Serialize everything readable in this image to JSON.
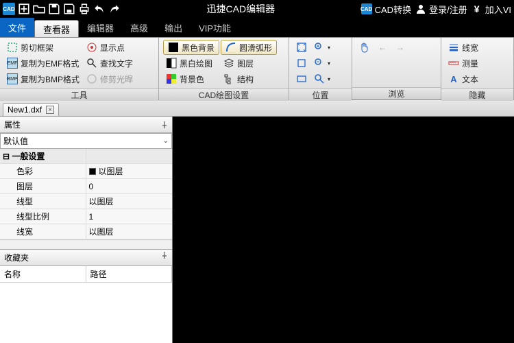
{
  "title": "迅捷CAD编辑器",
  "titlebar_right": {
    "convert": "CAD转换",
    "login": "登录/注册",
    "join": "加入VI"
  },
  "menu": {
    "file": "文件",
    "viewer": "查看器",
    "editor": "编辑器",
    "advanced": "高级",
    "output": "输出",
    "vip": "VIP功能"
  },
  "ribbon": {
    "tools": {
      "cut_frame": "剪切框架",
      "copy_emf": "复制为EMF格式",
      "copy_bmp": "复制为BMP格式",
      "title": "工具"
    },
    "disp": {
      "show_point": "显示点",
      "find_text": "查找文字",
      "trim_disc": "修剪光晘"
    },
    "cad": {
      "black_bg": "黑色背景",
      "bw_draw": "黑白绘图",
      "bg_color": "背景色",
      "smooth_arc": "圆滑弧形",
      "layer": "图层",
      "structure": "结构",
      "title": "CAD绘图设置"
    },
    "position": {
      "title": "位置"
    },
    "browse": {
      "title": "浏览"
    },
    "hide": {
      "linewidth": "线宽",
      "measure": "测量",
      "text": "文本",
      "title": "隐藏"
    }
  },
  "doc": {
    "name": "New1.dxf"
  },
  "props": {
    "header": "属性",
    "default": "默认值",
    "section": "一般设置",
    "rows": {
      "color_l": "色彩",
      "color_v": "以图层",
      "layer_l": "图层",
      "layer_v": "0",
      "linetype_l": "线型",
      "linetype_v": "以图层",
      "ltscale_l": "线型比例",
      "ltscale_v": "1",
      "lweight_l": "线宽",
      "lweight_v": "以图层"
    }
  },
  "fav": {
    "header": "收藏夹",
    "col_name": "名称",
    "col_path": "路径"
  }
}
